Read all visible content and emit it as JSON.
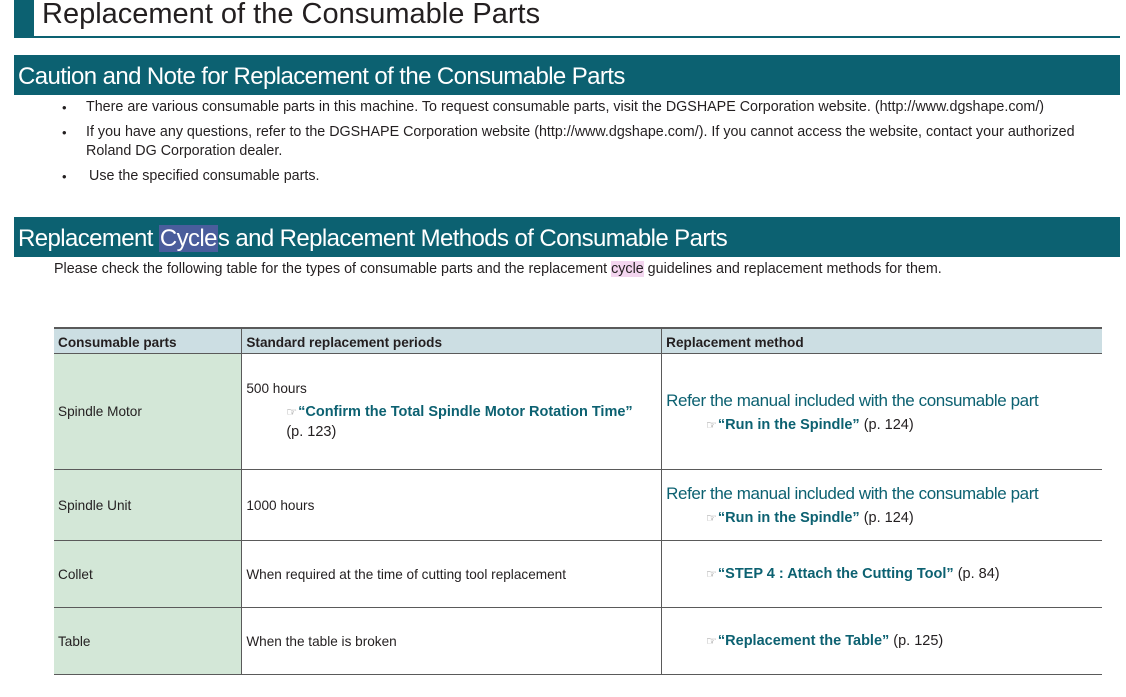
{
  "page_title": "Replacement of the Consumable Parts",
  "section1": {
    "title": "Caution and Note for Replacement of the Consumable Parts",
    "bullets": [
      "There are various consumable parts in this machine. To request consumable parts, visit the DGSHAPE Corporation website. (http://www.dgshape.com/)",
      "If you have any questions, refer to the DGSHAPE Corporation website (http://www.dgshape.com/). If you cannot access the website, contact your authorized Roland DG Corporation dealer.",
      "Use the specified consumable parts."
    ]
  },
  "section2": {
    "title_pre": "Replacement ",
    "title_highlight": "Cycle",
    "title_post": "s and Replacement Methods of Consumable Parts",
    "intro_pre": "Please check the following table for the types of consumable parts and the replacement ",
    "intro_highlight": "cycle",
    "intro_post": " guidelines and replacement methods for them."
  },
  "table": {
    "headers": [
      "Consumable parts",
      "Standard replacement periods",
      "Replacement method"
    ],
    "hand_icon": "☞",
    "rows": [
      {
        "part": "Spindle Motor",
        "period": "500 hours",
        "period_ref_title": "“Confirm the Total Spindle Motor Rotation Time”",
        "period_ref_page": "(p. 123)",
        "method_note": "Refer the manual included with the consumable part",
        "method_ref_title": "“Run in the Spindle”",
        "method_ref_page": " (p. 124)"
      },
      {
        "part": "Spindle Unit",
        "period": "1000 hours",
        "method_note": "Refer the manual included with the consumable part",
        "method_ref_title": "“Run in the Spindle”",
        "method_ref_page": " (p. 124)"
      },
      {
        "part": "Collet",
        "period": "When required at the time of cutting tool replacement",
        "method_ref_title": "“STEP 4 : Attach the Cutting Tool”",
        "method_ref_page": " (p. 84)"
      },
      {
        "part": "Table",
        "period": "When the table is broken",
        "method_ref_title": "“Replacement the Table”",
        "method_ref_page": " (p. 125)"
      }
    ]
  },
  "colors": {
    "accent": "#0c6171",
    "header_row": "#ccdee3",
    "part_column": "#d3e7d7",
    "highlight_cycle": "#f3d5ef",
    "highlight_title": "#4a5d9c"
  }
}
